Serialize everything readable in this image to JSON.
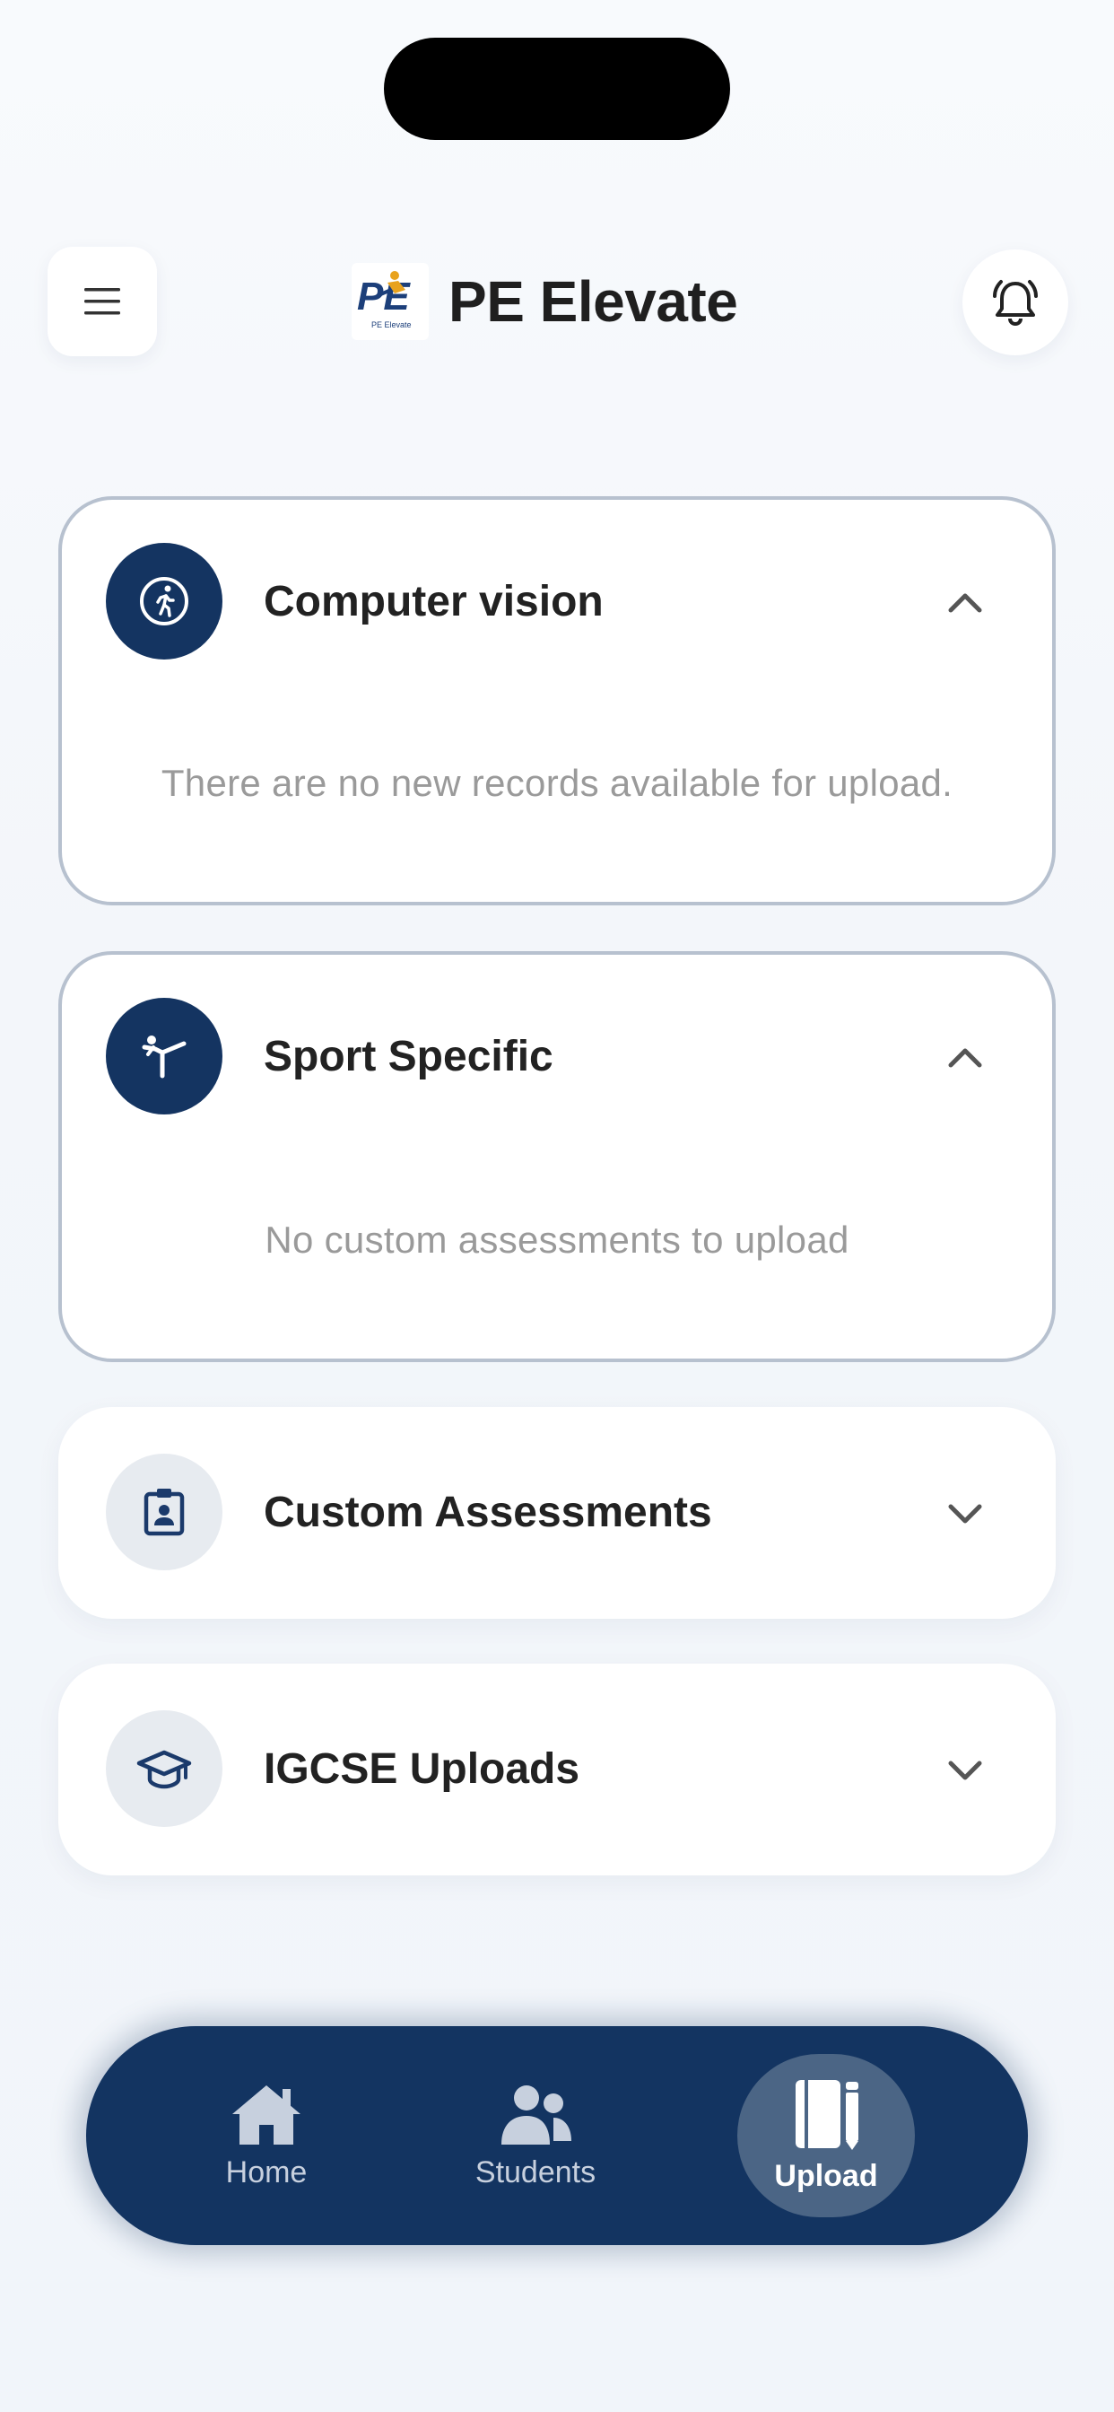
{
  "header": {
    "app_title": "PE Elevate",
    "logo_text": "PE",
    "logo_subtext": "PE Elevate"
  },
  "sections": [
    {
      "title": "Computer vision",
      "expanded": true,
      "icon": "running-person-icon",
      "empty_message": "There are no new records available for upload."
    },
    {
      "title": "Sport Specific",
      "expanded": true,
      "icon": "karate-kick-icon",
      "empty_message": "No custom assessments to upload"
    },
    {
      "title": "Custom Assessments",
      "expanded": false,
      "icon": "id-badge-icon"
    },
    {
      "title": "IGCSE Uploads",
      "expanded": false,
      "icon": "graduation-cap-icon"
    }
  ],
  "nav": {
    "items": [
      {
        "label": "Home",
        "icon": "home-icon",
        "active": false
      },
      {
        "label": "Students",
        "icon": "users-icon",
        "active": false
      },
      {
        "label": "Upload",
        "icon": "notebook-pen-icon",
        "active": true
      }
    ]
  },
  "colors": {
    "primary": "#143461",
    "nav_active": "#4b6585",
    "card_border": "#b7c1cf",
    "muted_text": "#9a9a9a"
  }
}
